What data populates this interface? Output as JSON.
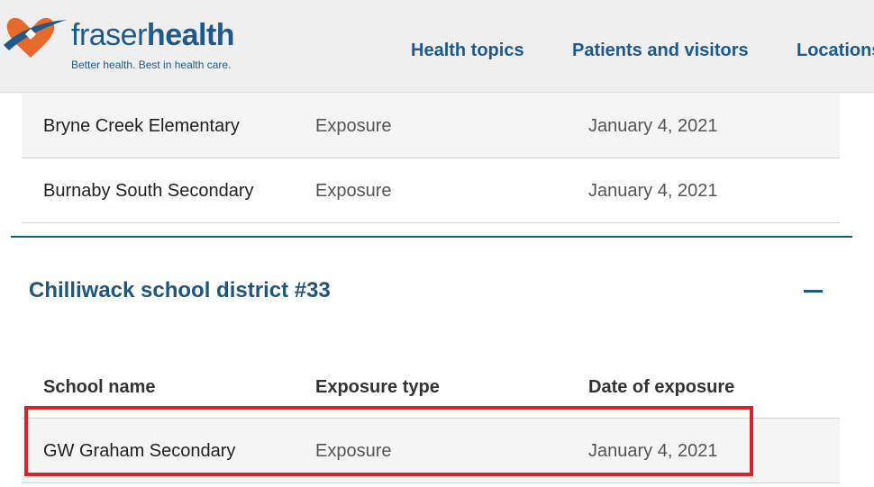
{
  "header": {
    "logo": {
      "brand_light": "fraser",
      "brand_bold": "health",
      "tagline": "Better health. Best in health care."
    },
    "nav": [
      {
        "label": "Health topics"
      },
      {
        "label": "Patients and visitors"
      },
      {
        "label": "Locations"
      }
    ]
  },
  "upper_table": {
    "rows": [
      {
        "school": "Bryne Creek Elementary",
        "type": "Exposure",
        "date": "January 4, 2021"
      },
      {
        "school": "Burnaby South Secondary",
        "type": "Exposure",
        "date": "January 4, 2021"
      }
    ]
  },
  "section": {
    "title": "Chilliwack school district #33",
    "toggle_icon": "minus-icon",
    "table": {
      "columns": [
        "School name",
        "Exposure type",
        "Date of exposure"
      ],
      "rows": [
        {
          "school": "GW Graham Secondary",
          "type": "Exposure",
          "date": "January 4, 2021",
          "highlighted": true
        }
      ]
    }
  },
  "colors": {
    "brand_blue": "#1f5a8d",
    "logo_orange": "#e8692c",
    "highlight_red": "#d7242b",
    "section_rule": "#1b5a7e"
  }
}
